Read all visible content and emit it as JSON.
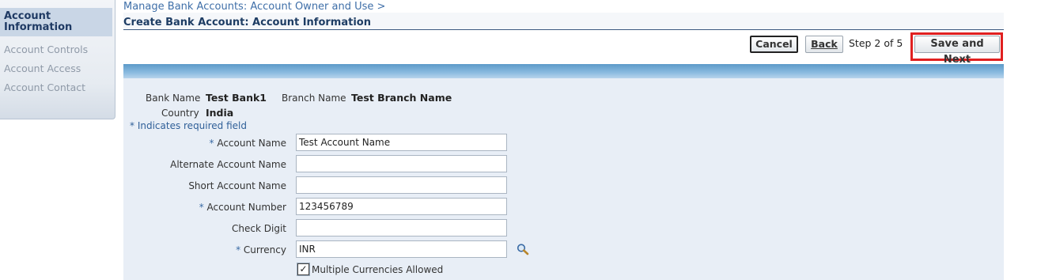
{
  "sidebar": {
    "active_item": "Account Information",
    "items": [
      {
        "label": "Account Controls"
      },
      {
        "label": "Account Access"
      },
      {
        "label": "Account Contact"
      }
    ]
  },
  "header": {
    "breadcrumb": "Manage Bank Accounts: Account Owner and Use  >",
    "page_title": "Create Bank Account: Account Information"
  },
  "toolbar": {
    "cancel_label": "Cancel",
    "back_label": "Back",
    "step_text": "Step 2 of 5",
    "save_next_label": "Save and Next"
  },
  "bank_info": {
    "bank_name_label": "Bank Name",
    "bank_name_value": "Test Bank1",
    "branch_name_label": "Branch Name",
    "branch_name_value": "Test Branch Name",
    "country_label": "Country",
    "country_value": "India"
  },
  "required_note": "*  Indicates required field",
  "form": {
    "account_name": {
      "label": "Account Name",
      "value": "Test Account Name",
      "required": true
    },
    "alternate_account_name": {
      "label": "Alternate Account Name",
      "value": ""
    },
    "short_account_name": {
      "label": "Short Account Name",
      "value": ""
    },
    "account_number": {
      "label": "Account Number",
      "value": "123456789",
      "required": true
    },
    "check_digit": {
      "label": "Check Digit",
      "value": ""
    },
    "currency": {
      "label": "Currency",
      "value": "INR",
      "required": true
    },
    "multiple_currencies": {
      "label": "Multiple Currencies Allowed",
      "checked": true
    }
  },
  "icons": {
    "search": "search-icon",
    "checkmark": "✓"
  },
  "colors": {
    "highlight": "#e02020",
    "link": "#3f6fa8",
    "header_bar": "#5c9ac9"
  }
}
